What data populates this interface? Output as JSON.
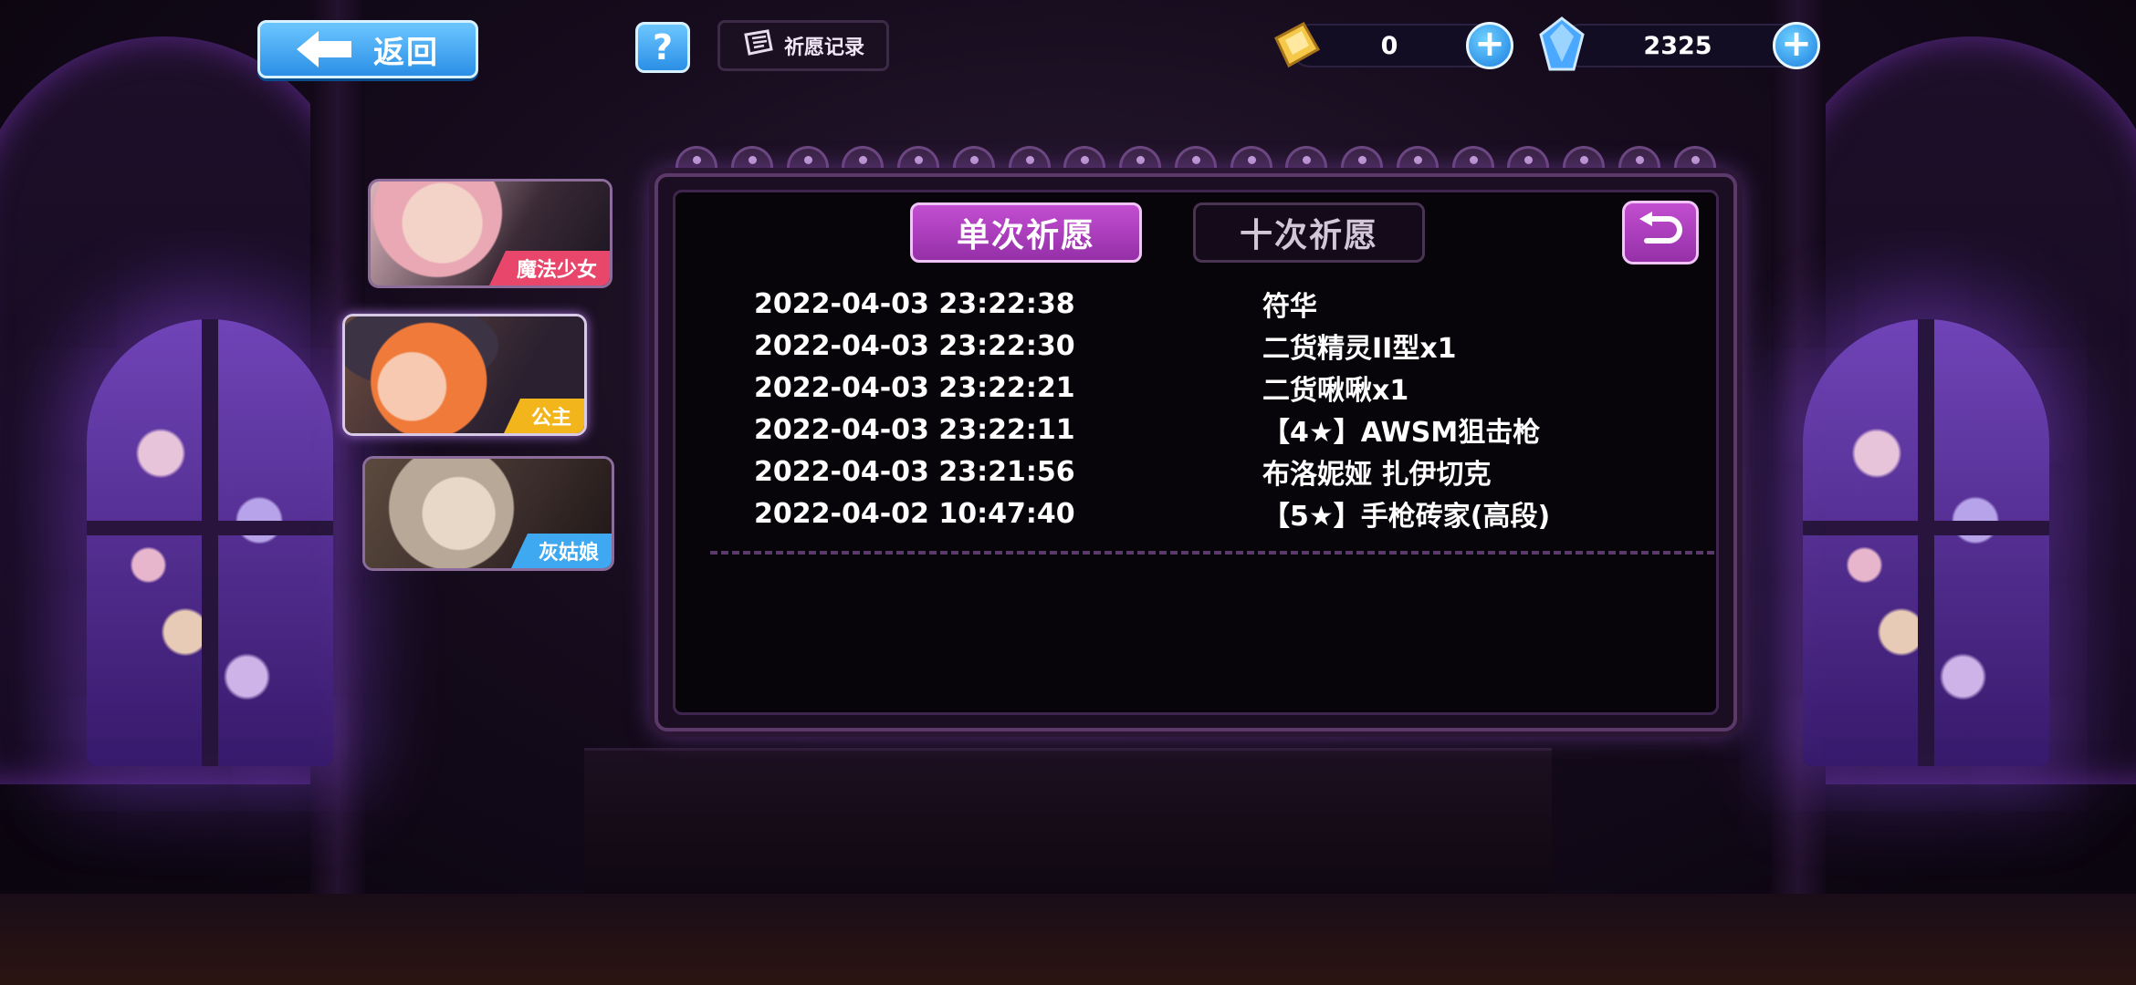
{
  "header": {
    "back_label": "返回",
    "help_label": "?",
    "record_label": "祈愿记录"
  },
  "currencies": [
    {
      "name": "gold-ticket",
      "value": "0",
      "icon": "golden-ticket-icon",
      "color": "#f5c84a"
    },
    {
      "name": "crystal",
      "value": "2325",
      "icon": "blue-crystal-icon",
      "color": "#4aa8ff"
    }
  ],
  "characters": [
    {
      "tag": "魔法少女",
      "tag_color": "#e8476b",
      "selected": false
    },
    {
      "tag": "公主",
      "tag_color": "#f2b51c",
      "selected": true
    },
    {
      "tag": "灰姑娘",
      "tag_color": "#3ea8f0",
      "selected": false
    }
  ],
  "tabs": {
    "single": "单次祈愿",
    "ten": "十次祈愿",
    "active": "single"
  },
  "records": [
    {
      "time": "2022-04-03 23:22:38",
      "item": "符华"
    },
    {
      "time": "2022-04-03 23:22:30",
      "item": "二货精灵II型x1"
    },
    {
      "time": "2022-04-03 23:22:21",
      "item": "二货啾啾x1"
    },
    {
      "time": "2022-04-03 23:22:11",
      "item": "【4★】AWSM狙击枪"
    },
    {
      "time": "2022-04-03 23:21:56",
      "item": "布洛妮娅 扎伊切克"
    },
    {
      "time": "2022-04-02 10:47:40",
      "item": "【5★】手枪砖家(高段)"
    }
  ],
  "colors": {
    "accent_purple": "#b03fc2",
    "button_blue": "#2b8fe6",
    "panel_border": "#5b3a6a"
  }
}
